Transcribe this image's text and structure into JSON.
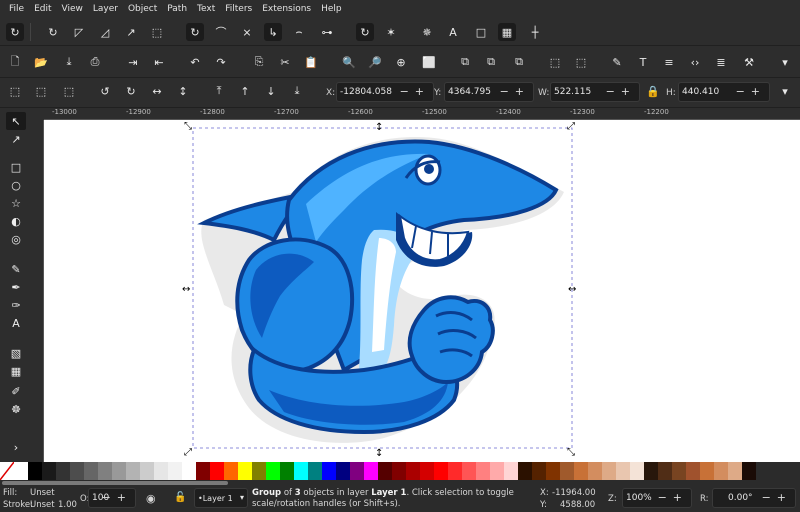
{
  "menu": [
    "File",
    "Edit",
    "View",
    "Layer",
    "Object",
    "Path",
    "Text",
    "Filters",
    "Extensions",
    "Help"
  ],
  "toolbar": {
    "x_label": "X:",
    "x_value": "-12804.058",
    "y_label": "Y:",
    "y_value": "4364.795",
    "w_label": "W:",
    "w_value": "522.115",
    "h_label": "H:",
    "h_value": "440.410"
  },
  "ruler_ticks": [
    "-13000",
    "-12900",
    "-12800",
    "-12700",
    "-12600",
    "-12500",
    "-12400",
    "-12300",
    "-12200"
  ],
  "palette": [
    "#ffffff",
    "#000000",
    "#1a1a1a",
    "#333333",
    "#4d4d4d",
    "#666666",
    "#808080",
    "#999999",
    "#b3b3b3",
    "#cccccc",
    "#e6e6e6",
    "#f2f2f2",
    "#ffffff",
    "#800000",
    "#ff0000",
    "#ff6600",
    "#ffff00",
    "#808000",
    "#00ff00",
    "#008000",
    "#00ffff",
    "#008080",
    "#0000ff",
    "#000080",
    "#800080",
    "#ff00ff",
    "#550000",
    "#800000",
    "#aa0000",
    "#d40000",
    "#ff0000",
    "#ff2a2a",
    "#ff5555",
    "#ff8080",
    "#ffaaaa",
    "#ffd5d5",
    "#2b1100",
    "#552200",
    "#803300",
    "#a05a2c",
    "#c87137",
    "#d38d5f",
    "#deaa87",
    "#e9c6af",
    "#f4e3d7",
    "#28170b",
    "#502d16",
    "#784421",
    "#a0522d",
    "#c87137",
    "#d38d5f",
    "#deaa87",
    "#1a0b06"
  ],
  "status": {
    "fill_label": "Fill:",
    "fill_value": "Unset",
    "stroke_label": "Stroke:",
    "stroke_value": "Unset",
    "stroke_width": "1.00",
    "opacity_label": "O:",
    "opacity_value": "100",
    "layer_value": "•Layer 1",
    "message_a": "Group",
    "message_b": " of ",
    "message_c": "3",
    "message_d": " objects in layer ",
    "message_e": "Layer 1",
    "message_f": ". Click selection to toggle",
    "message_g": "scale/rotation handles (or Shift+s).",
    "x_label": "X:",
    "x_value": "-11964.00",
    "y_label": "Y:",
    "y_value": "4588.00",
    "zoom_label": "Z:",
    "zoom_value": "100%",
    "rotation_label": "R:",
    "rotation_value": "0.00°"
  },
  "colors": {
    "shark_dark": "#0a3d8f",
    "shark_mid": "#1e88e5",
    "shark_light": "#4fb3ff",
    "belly": "#a8dcff"
  }
}
